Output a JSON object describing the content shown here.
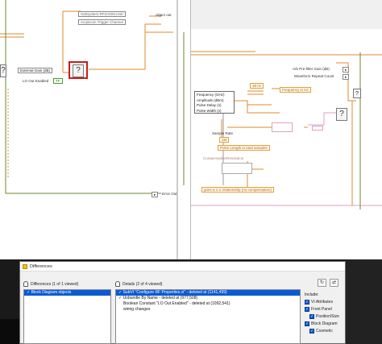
{
  "left_diagram": {
    "top_node_1": "Subsystem.RF.EXSM.Instr",
    "top_node_2": "Acqiscom.Trigger Channel",
    "object_out": "object out",
    "ext_gain_label": "External Gain (dB)",
    "lo_out_label": "LO Out Enabled",
    "lo_out_value": "TF",
    "error_out": "Error Out"
  },
  "right_diagram": {
    "arb_gain_label": "Arb Pre-filter Gain (dB)",
    "waveform_label": "Waveform Repeat Count",
    "cluster_items": [
      "Frequency (GHz)",
      "Amplitude (dBm)",
      "Pulse Delay (s)",
      "Pulse Width (s)"
    ],
    "freq_const": "1E+9",
    "freq_hz_label": "Frequency in Hz",
    "sample_rate_label": "Sample Rate",
    "sample_rate_value": "1M",
    "pulse_length_label": "Pulse Length in total samples",
    "comp_label": "CompensationResolution",
    "comp_note": "goes a 1-1 relationship (no compensation)"
  },
  "dialog": {
    "title": "Differences",
    "left_header": "Differences (1 of 1 viewed)",
    "left_rows": [
      "Block Diagram objects"
    ],
    "right_header": "Details (2 of 4 viewed)",
    "right_rows": [
      "SubVI \"Configure RF Properties.vi\" - deleted at (1141,499)",
      "Unbundle By Name - deleted at (977,508)",
      "Boolean Constant \"LO Out Enabled\" - deleted at (1092,541)",
      "wiring changes"
    ],
    "include_label": "Include:",
    "options": [
      {
        "label": "VI Attributes",
        "checked": true
      },
      {
        "label": "Front Panel",
        "checked": true
      },
      {
        "label": "Position/Size",
        "checked": true
      },
      {
        "label": "Block Diagram",
        "checked": true
      },
      {
        "label": "Cosmetic",
        "checked": true
      }
    ],
    "refresh_symbol": "↻",
    "nav_symbol": "⇄"
  },
  "colors": {
    "selection": "#0a5ad4",
    "highlight_box": "#d01818",
    "wire_orange": "#e08a2c",
    "wire_green": "#6a8a2a"
  }
}
